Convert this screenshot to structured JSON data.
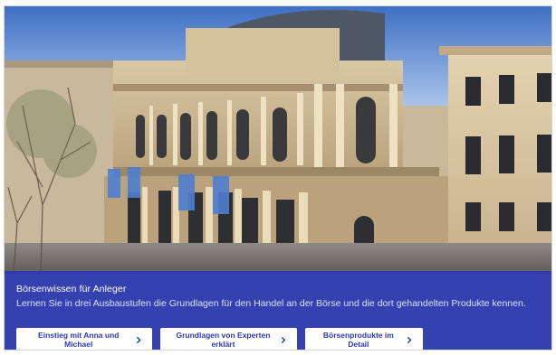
{
  "hero": {
    "image_description": "Frankfurter Wertpapierbörse"
  },
  "panel": {
    "title": "Börsenwissen für Anleger",
    "description": "Lernen Sie in drei Ausbaustufen die Grundlagen für den Handel an der Börse und die dort gehandelten Produkte kennen.",
    "background_color": "#2b38b2"
  },
  "buttons": [
    {
      "label": "Einstieg mit Anna und Michael",
      "icon": "chevron-right-icon"
    },
    {
      "label": "Grundlagen von Experten erklärt",
      "icon": "chevron-right-icon"
    },
    {
      "label": "Börsenprodukte im Detail",
      "icon": "chevron-right-icon"
    }
  ]
}
